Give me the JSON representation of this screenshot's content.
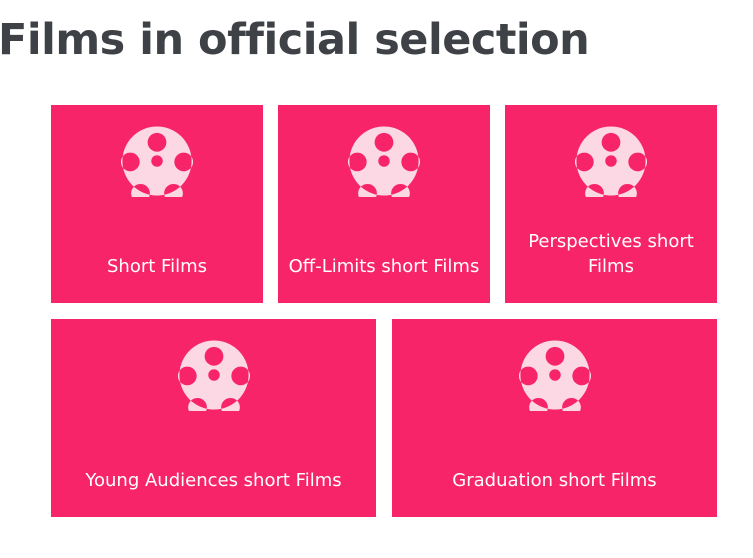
{
  "page": {
    "title": "Films in official selection"
  },
  "colors": {
    "tile_background": "#f72469",
    "icon_color": "#fbd8e4",
    "title_color": "#3e4247",
    "label_color": "#ffffff"
  },
  "categories": [
    {
      "label": "Short Films",
      "icon": "film-reel-icon"
    },
    {
      "label": "Off-Limits short Films",
      "icon": "film-reel-icon"
    },
    {
      "label": "Perspectives short Films",
      "icon": "film-reel-icon"
    },
    {
      "label": "Young Audiences short Films",
      "icon": "film-reel-icon"
    },
    {
      "label": "Graduation short Films",
      "icon": "film-reel-icon"
    }
  ]
}
